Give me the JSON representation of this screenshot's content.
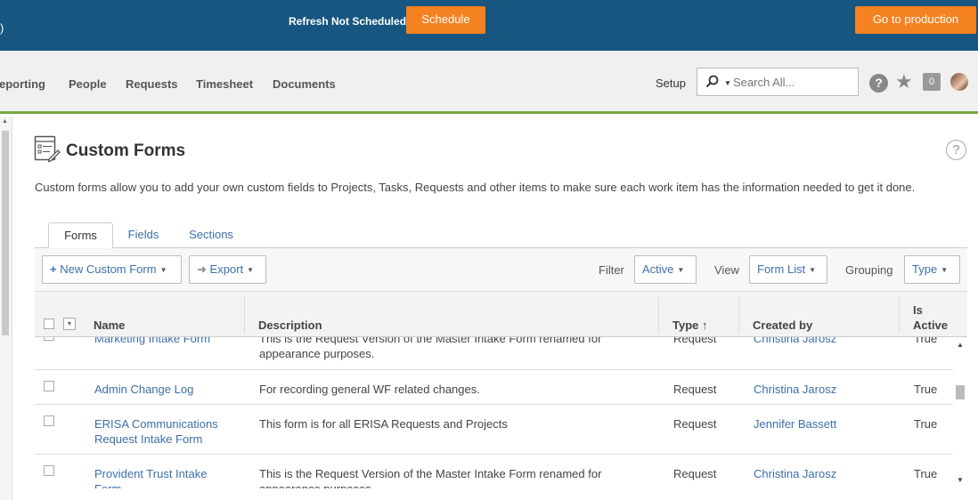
{
  "banner": {
    "edge_text": ")",
    "refresh_label": "Refresh Not Scheduled:",
    "schedule_button": "Schedule",
    "production_button": "Go to production"
  },
  "nav": {
    "items": [
      "eporting",
      "People",
      "Requests",
      "Timesheet",
      "Documents"
    ],
    "setup": "Setup",
    "search_placeholder": "Search All...",
    "help": "?",
    "notifications_count": "0"
  },
  "page": {
    "title": "Custom Forms",
    "help": "?",
    "description": "Custom forms allow you to add your own custom fields to Projects, Tasks, Requests and other items to make sure each work item has the information needed to get it done."
  },
  "tabs": [
    {
      "label": "Forms",
      "active": true
    },
    {
      "label": "Fields",
      "active": false
    },
    {
      "label": "Sections",
      "active": false
    }
  ],
  "toolbar": {
    "new_form": "New Custom Form",
    "export": "Export",
    "filter_label": "Filter",
    "filter_value": "Active",
    "view_label": "View",
    "view_value": "Form List",
    "grouping_label": "Grouping",
    "grouping_value": "Type"
  },
  "table": {
    "columns": {
      "name": "Name",
      "description": "Description",
      "type": "Type",
      "type_sort": "↑",
      "created_by": "Created by",
      "is_active": "Is Active"
    },
    "rows": [
      {
        "name": "Marketing Intake Form",
        "description": "This is the Request Version of the Master Intake Form renamed for appearance purposes.",
        "type": "Request",
        "created_by": "Christina Jarosz",
        "is_active": "True"
      },
      {
        "name": "Admin Change Log",
        "description": "For recording general WF related changes.",
        "type": "Request",
        "created_by": "Christina Jarosz",
        "is_active": "True"
      },
      {
        "name": "ERISA Communications Request Intake Form",
        "description": "This form is for all ERISA Requests and Projects",
        "type": "Request",
        "created_by": "Jennifer Bassett",
        "is_active": "True"
      },
      {
        "name": "Provident Trust Intake Form",
        "description": "This is the Request Version of the Master Intake Form renamed for appearance purposes.",
        "type": "Request",
        "created_by": "Christina Jarosz",
        "is_active": "True"
      }
    ]
  },
  "colors": {
    "banner_bg": "#165680",
    "accent_orange": "#f58220",
    "nav_underline": "#7ba843",
    "link_blue": "#3d6fa8"
  }
}
